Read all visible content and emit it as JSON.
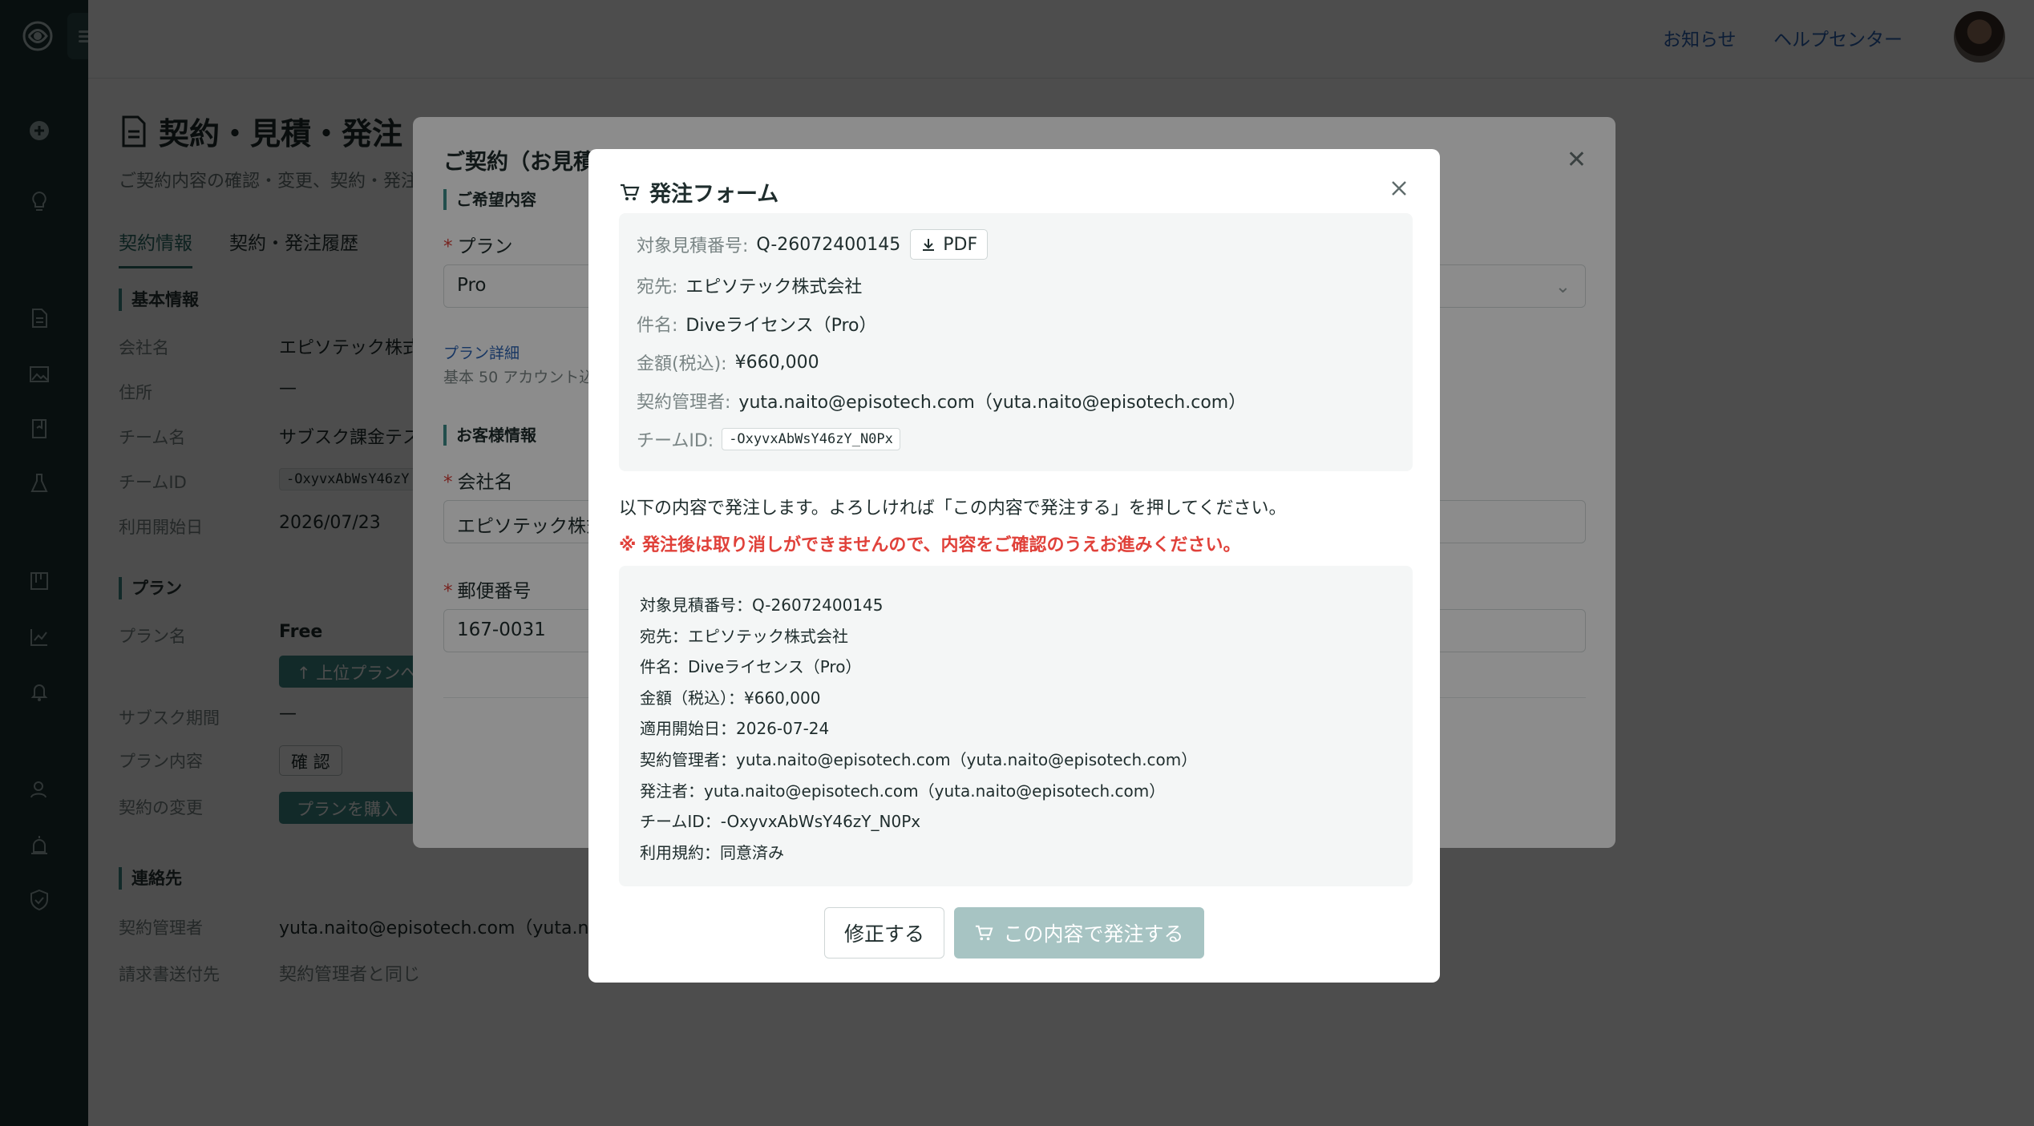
{
  "header": {
    "notice_link": "お知らせ",
    "help_link": "ヘルプセンター"
  },
  "page": {
    "title": "契約・見積・発注",
    "subtitle": "ご契約内容の確認・変更、契約・発注",
    "tabs": [
      {
        "label": "契約情報"
      },
      {
        "label": "契約・発注履歴"
      }
    ],
    "basic": {
      "heading": "基本情報",
      "company_label": "会社名",
      "company_value": "エピソテック株式",
      "address_label": "住所",
      "address_value": "—",
      "team_label": "チーム名",
      "team_value": "サブスク課金テス",
      "teamid_label": "チームID",
      "teamid_value": "-OxyvxAbWsY46zY",
      "start_label": "利用開始日",
      "start_value": "2026/07/23"
    },
    "plan": {
      "heading": "プラン",
      "name_label": "プラン名",
      "name_value": "Free",
      "upgrade_button": "上位プランへ",
      "period_label": "サブスク期間",
      "period_value": "—",
      "content_label": "プラン内容",
      "content_button": "確 認",
      "change_label": "契約の変更",
      "purchase_button": "プランを購入"
    },
    "contact": {
      "heading": "連絡先",
      "manager_label": "契約管理者",
      "manager_value": "yuta.naito@episotech.com（yuta.nait",
      "billing_label": "請求書送付先",
      "billing_value": "契約管理者と同じ"
    }
  },
  "contract_modal": {
    "title": "ご契約（お見積",
    "desired_heading": "ご希望内容",
    "plan_label": "プラン",
    "plan_value": "Pro",
    "plan_detail_link": "プラン詳細",
    "plan_hint": "基本 50 アカウント込",
    "customer_heading": "お客様情報",
    "company_label": "会社名",
    "company_value": "エピソテック株式",
    "zip_label": "郵便番号",
    "zip_value": "167-0031"
  },
  "order_modal": {
    "title": "発注フォーム",
    "quote_label": "対象見積番号:",
    "quote_value": "Q-26072400145",
    "pdf_button": "PDF",
    "to_label": "宛先:",
    "to_value": "エピソテック株式会社",
    "subject_label": "件名:",
    "subject_value": "Diveライセンス（Pro）",
    "amount_label": "金額(税込):",
    "amount_value": "¥660,000",
    "manager_label": "契約管理者:",
    "manager_value": "yuta.naito@episotech.com（yuta.naito@episotech.com）",
    "teamid_label": "チームID:",
    "teamid_value": "-OxyvxAbWsY46zY_N0Px",
    "message": "以下の内容で発注します。よろしければ「この内容で発注する」を押してください。",
    "warning": "※ 発注後は取り消しができませんので、内容をご確認のうえお進みください。",
    "summary": [
      "対象見積番号：Q-26072400145",
      "宛先：エピソテック株式会社",
      "件名：Diveライセンス（Pro）",
      "金額（税込）：¥660,000",
      "適用開始日：2026-07-24",
      "契約管理者：yuta.naito@episotech.com（yuta.naito@episotech.com）",
      "発注者：yuta.naito@episotech.com（yuta.naito@episotech.com）",
      "チームID：-OxyvxAbWsY46zY_N0Px",
      "利用規約：同意済み"
    ],
    "edit_button": "修正する",
    "submit_button": "この内容で発注する"
  },
  "colors": {
    "rail": "#1c3334",
    "accent": "#3f8f8b",
    "warning": "#e0413a",
    "link": "#2b63b5",
    "submit_disabled": "#a7c4c3"
  },
  "icons": [
    "logo-icon",
    "menu-icon",
    "plus-circle-icon",
    "lightbulb-icon",
    "document-icon",
    "image-icon",
    "book-icon",
    "flask-icon",
    "board-icon",
    "chart-icon",
    "bell-icon",
    "user-icon",
    "alarm-icon",
    "shield-icon",
    "cart-icon",
    "download-icon",
    "close-icon"
  ]
}
